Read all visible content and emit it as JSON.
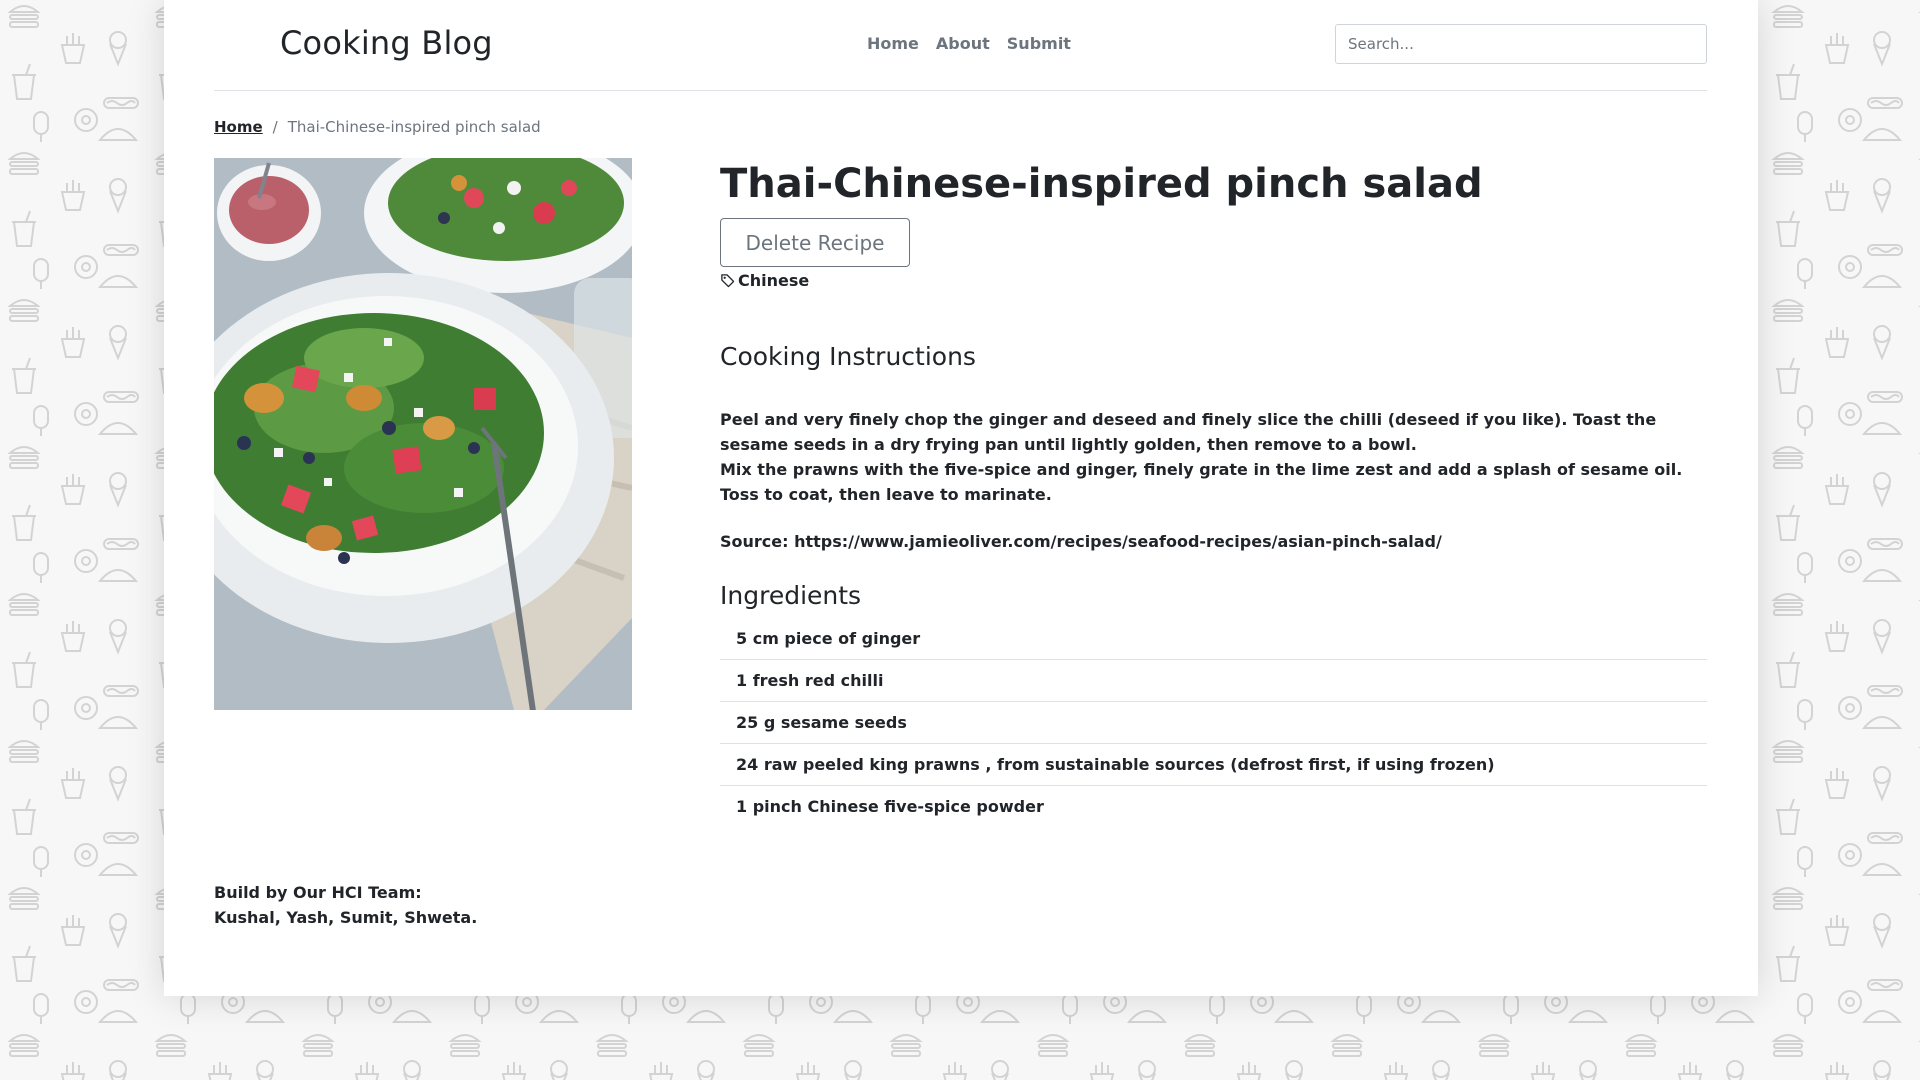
{
  "header": {
    "brand": "Cooking Blog",
    "nav": [
      "Home",
      "About",
      "Submit"
    ],
    "search_placeholder": "Search..."
  },
  "breadcrumb": {
    "home": "Home",
    "separator": "/",
    "current": "Thai-Chinese-inspired pinch salad"
  },
  "recipe": {
    "title": "Thai-Chinese-inspired pinch salad",
    "delete_label": "Delete Recipe",
    "tag": "Chinese",
    "instructions_heading": "Cooking Instructions",
    "instructions": [
      "Peel and very finely chop the ginger and deseed and finely slice the chilli (deseed if you like). Toast the sesame seeds in a dry frying pan until lightly golden, then remove to a bowl.",
      "Mix the prawns with the five-spice and ginger, finely grate in the lime zest and add a splash of sesame oil. Toss to coat, then leave to marinate."
    ],
    "source": "Source: https://www.jamieoliver.com/recipes/seafood-recipes/asian-pinch-salad/",
    "ingredients_heading": "Ingredients",
    "ingredients": [
      "5 cm piece of ginger",
      "1 fresh red chilli",
      "25 g sesame seeds",
      "24 raw peeled king prawns , from sustainable sources (defrost first, if using frozen)",
      "1 pinch Chinese five-spice powder"
    ]
  },
  "footer": {
    "line1": "Build by Our HCI Team:",
    "line2": "Kushal, Yash, Sumit, Shweta."
  },
  "icons": {
    "tag": "tag-icon",
    "background": "food-doodle-pattern"
  },
  "colors": {
    "text": "#212529",
    "muted": "#6c757d",
    "border": "#dee2e6",
    "page_background": "#f7f7f7"
  }
}
